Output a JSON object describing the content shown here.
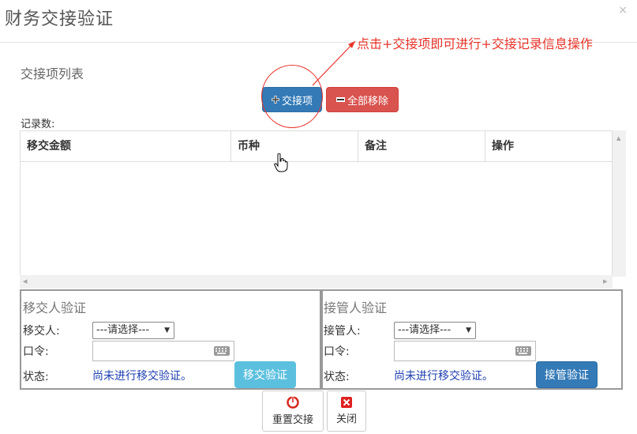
{
  "dialog": {
    "title": "财务交接验证",
    "close_glyph": "×"
  },
  "annotation": {
    "text": "点击+交接项即可进行+交接记录信息操作",
    "color": "#e8332a"
  },
  "list": {
    "title": "交接项列表",
    "add_button": "交接项",
    "remove_button": "全部移除",
    "record_count_label": "记录数:",
    "columns": [
      "移交金额",
      "币种",
      "备注",
      "操作"
    ],
    "rows": []
  },
  "handover_panel": {
    "title": "移交人验证",
    "person_label": "移交人:",
    "person_select_value": "---请选择---",
    "password_label": "口令:",
    "password_value": "",
    "status_label": "状态:",
    "status_text": "尚未进行移交验证。",
    "verify_button": "移交验证"
  },
  "takeover_panel": {
    "title": "接管人验证",
    "person_label": "接管人:",
    "person_select_value": "---请选择---",
    "password_label": "口令:",
    "password_value": "",
    "status_label": "状态:",
    "status_text": "尚未进行移交验证。",
    "verify_button": "接管验证"
  },
  "footer": {
    "reset_button": "重置交接",
    "close_button": "关闭"
  },
  "colors": {
    "primary": "#337ab7",
    "danger": "#d9534f",
    "info_disabled": "#5bc0de",
    "status_text": "#1f3fb0"
  },
  "icons": {
    "add": "plus-icon",
    "remove": "minus-icon",
    "reset": "reset-icon",
    "close": "close-x-icon",
    "keyboard": "keyboard-icon",
    "cursor": "hand-pointer-icon"
  }
}
